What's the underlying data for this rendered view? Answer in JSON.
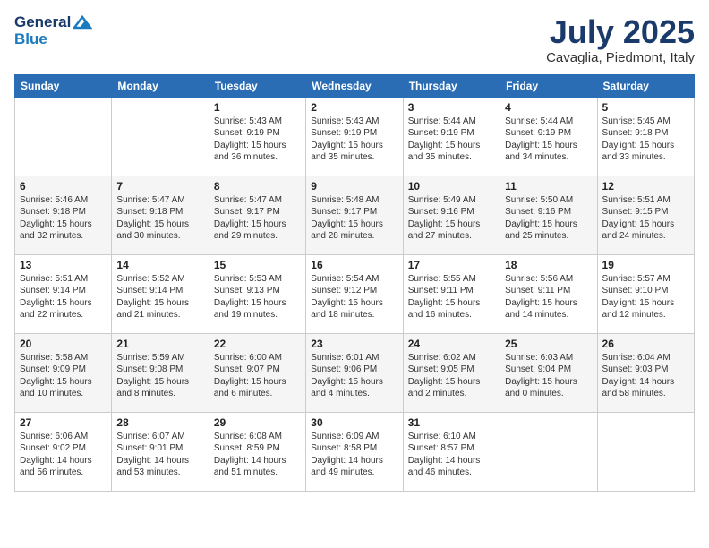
{
  "header": {
    "logo_general": "General",
    "logo_blue": "Blue",
    "month_year": "July 2025",
    "location": "Cavaglia, Piedmont, Italy"
  },
  "days_of_week": [
    "Sunday",
    "Monday",
    "Tuesday",
    "Wednesday",
    "Thursday",
    "Friday",
    "Saturday"
  ],
  "weeks": [
    [
      {
        "day": "",
        "info": ""
      },
      {
        "day": "",
        "info": ""
      },
      {
        "day": "1",
        "info": "Sunrise: 5:43 AM\nSunset: 9:19 PM\nDaylight: 15 hours\nand 36 minutes."
      },
      {
        "day": "2",
        "info": "Sunrise: 5:43 AM\nSunset: 9:19 PM\nDaylight: 15 hours\nand 35 minutes."
      },
      {
        "day": "3",
        "info": "Sunrise: 5:44 AM\nSunset: 9:19 PM\nDaylight: 15 hours\nand 35 minutes."
      },
      {
        "day": "4",
        "info": "Sunrise: 5:44 AM\nSunset: 9:19 PM\nDaylight: 15 hours\nand 34 minutes."
      },
      {
        "day": "5",
        "info": "Sunrise: 5:45 AM\nSunset: 9:18 PM\nDaylight: 15 hours\nand 33 minutes."
      }
    ],
    [
      {
        "day": "6",
        "info": "Sunrise: 5:46 AM\nSunset: 9:18 PM\nDaylight: 15 hours\nand 32 minutes."
      },
      {
        "day": "7",
        "info": "Sunrise: 5:47 AM\nSunset: 9:18 PM\nDaylight: 15 hours\nand 30 minutes."
      },
      {
        "day": "8",
        "info": "Sunrise: 5:47 AM\nSunset: 9:17 PM\nDaylight: 15 hours\nand 29 minutes."
      },
      {
        "day": "9",
        "info": "Sunrise: 5:48 AM\nSunset: 9:17 PM\nDaylight: 15 hours\nand 28 minutes."
      },
      {
        "day": "10",
        "info": "Sunrise: 5:49 AM\nSunset: 9:16 PM\nDaylight: 15 hours\nand 27 minutes."
      },
      {
        "day": "11",
        "info": "Sunrise: 5:50 AM\nSunset: 9:16 PM\nDaylight: 15 hours\nand 25 minutes."
      },
      {
        "day": "12",
        "info": "Sunrise: 5:51 AM\nSunset: 9:15 PM\nDaylight: 15 hours\nand 24 minutes."
      }
    ],
    [
      {
        "day": "13",
        "info": "Sunrise: 5:51 AM\nSunset: 9:14 PM\nDaylight: 15 hours\nand 22 minutes."
      },
      {
        "day": "14",
        "info": "Sunrise: 5:52 AM\nSunset: 9:14 PM\nDaylight: 15 hours\nand 21 minutes."
      },
      {
        "day": "15",
        "info": "Sunrise: 5:53 AM\nSunset: 9:13 PM\nDaylight: 15 hours\nand 19 minutes."
      },
      {
        "day": "16",
        "info": "Sunrise: 5:54 AM\nSunset: 9:12 PM\nDaylight: 15 hours\nand 18 minutes."
      },
      {
        "day": "17",
        "info": "Sunrise: 5:55 AM\nSunset: 9:11 PM\nDaylight: 15 hours\nand 16 minutes."
      },
      {
        "day": "18",
        "info": "Sunrise: 5:56 AM\nSunset: 9:11 PM\nDaylight: 15 hours\nand 14 minutes."
      },
      {
        "day": "19",
        "info": "Sunrise: 5:57 AM\nSunset: 9:10 PM\nDaylight: 15 hours\nand 12 minutes."
      }
    ],
    [
      {
        "day": "20",
        "info": "Sunrise: 5:58 AM\nSunset: 9:09 PM\nDaylight: 15 hours\nand 10 minutes."
      },
      {
        "day": "21",
        "info": "Sunrise: 5:59 AM\nSunset: 9:08 PM\nDaylight: 15 hours\nand 8 minutes."
      },
      {
        "day": "22",
        "info": "Sunrise: 6:00 AM\nSunset: 9:07 PM\nDaylight: 15 hours\nand 6 minutes."
      },
      {
        "day": "23",
        "info": "Sunrise: 6:01 AM\nSunset: 9:06 PM\nDaylight: 15 hours\nand 4 minutes."
      },
      {
        "day": "24",
        "info": "Sunrise: 6:02 AM\nSunset: 9:05 PM\nDaylight: 15 hours\nand 2 minutes."
      },
      {
        "day": "25",
        "info": "Sunrise: 6:03 AM\nSunset: 9:04 PM\nDaylight: 15 hours\nand 0 minutes."
      },
      {
        "day": "26",
        "info": "Sunrise: 6:04 AM\nSunset: 9:03 PM\nDaylight: 14 hours\nand 58 minutes."
      }
    ],
    [
      {
        "day": "27",
        "info": "Sunrise: 6:06 AM\nSunset: 9:02 PM\nDaylight: 14 hours\nand 56 minutes."
      },
      {
        "day": "28",
        "info": "Sunrise: 6:07 AM\nSunset: 9:01 PM\nDaylight: 14 hours\nand 53 minutes."
      },
      {
        "day": "29",
        "info": "Sunrise: 6:08 AM\nSunset: 8:59 PM\nDaylight: 14 hours\nand 51 minutes."
      },
      {
        "day": "30",
        "info": "Sunrise: 6:09 AM\nSunset: 8:58 PM\nDaylight: 14 hours\nand 49 minutes."
      },
      {
        "day": "31",
        "info": "Sunrise: 6:10 AM\nSunset: 8:57 PM\nDaylight: 14 hours\nand 46 minutes."
      },
      {
        "day": "",
        "info": ""
      },
      {
        "day": "",
        "info": ""
      }
    ]
  ]
}
